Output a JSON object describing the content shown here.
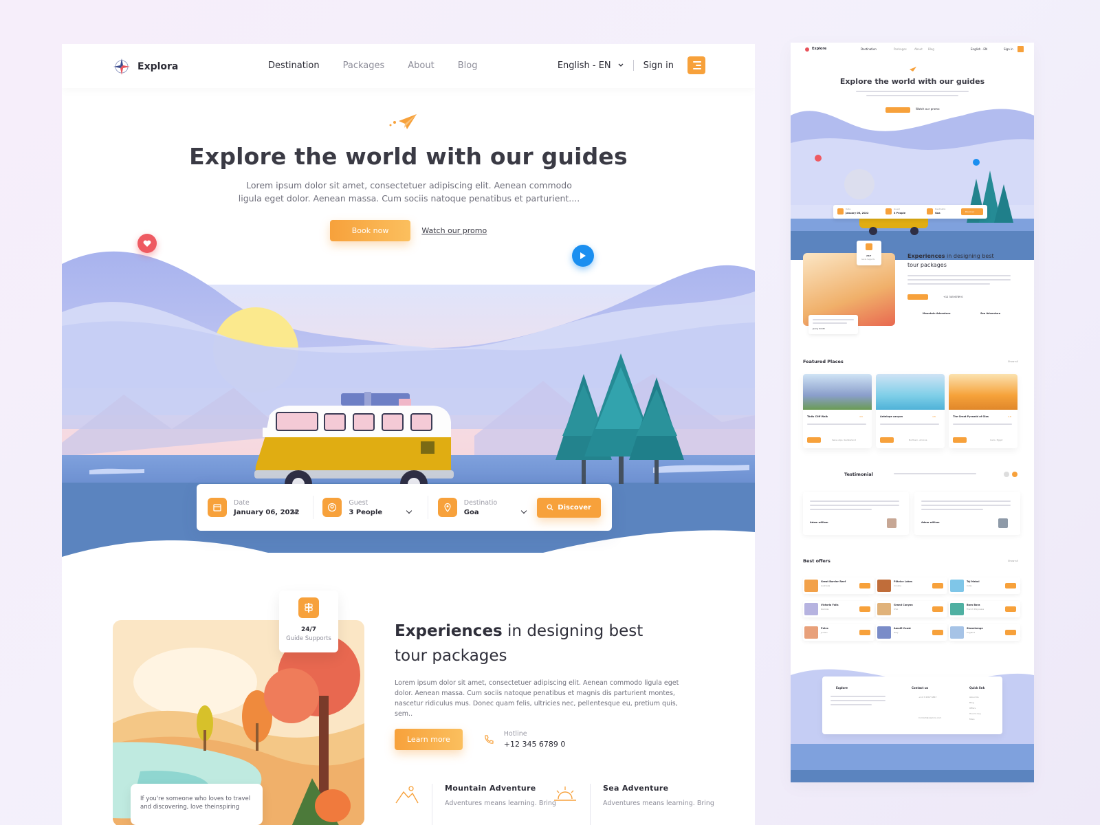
{
  "brand": {
    "name": "Explora",
    "accent": "#f7a13b"
  },
  "nav": {
    "links": [
      "Destination",
      "Packages",
      "About",
      "Blog"
    ],
    "language": "English - EN",
    "signin": "Sign in"
  },
  "hero": {
    "title": "Explore the world with our guides",
    "subtitle": "Lorem ipsum dolor sit amet, consectetuer adipiscing elit. Aenean commodo ligula eget dolor. Aenean massa. Cum sociis natoque penatibus et parturient....",
    "book_label": "Book now",
    "promo_label": "Watch our promo"
  },
  "search": {
    "date": {
      "label": "Date",
      "value": "January 06, 2022"
    },
    "guest": {
      "label": "Guest",
      "value": "3 People"
    },
    "destination": {
      "label": "Destinatio",
      "value": "Goa"
    },
    "discover_label": "Discover"
  },
  "experience": {
    "title_bold": "Experiences",
    "title_rest": " in designing best tour packages",
    "description": "Lorem ipsum dolor sit amet, consectetuer adipiscing elit. Aenean commodo ligula eget dolor. Aenean massa. Cum sociis natoque penatibus et magnis dis parturient montes, nascetur ridiculus mus. Donec quam felis, ultricies nec, pellentesque eu, pretium quis, sem..",
    "learn_label": "Learn more",
    "hotline_label": "Hotline",
    "hotline_value": "+12 345 6789 0",
    "guide_num": "24/7",
    "guide_label": "Guide Supports",
    "quote": "If you're someone who loves to travel and discovering, love theinspiring",
    "adventures": [
      {
        "title": "Mountain Adventure",
        "desc": "Adventures means learning. Bring"
      },
      {
        "title": "Sea Adventure",
        "desc": "Adventures means learning. Bring"
      }
    ]
  },
  "preview": {
    "brand": "Explore",
    "nav_links": [
      "Destination",
      "Packages",
      "About",
      "Blog"
    ],
    "lang": "English - EN",
    "signin": "Sign in",
    "hero_title": "Explore the world with our guides",
    "book": "Book now",
    "promo": "Watch our promo",
    "search": [
      {
        "label": "Date",
        "value": "January 06, 2022"
      },
      {
        "label": "Guest",
        "value": "3 People"
      },
      {
        "label": "Destinatio",
        "value": "Goa"
      }
    ],
    "discover": "Discover",
    "exp_title_bold": "Experiences",
    "exp_title_rest": " in designing best",
    "exp_title_line2": "tour packages",
    "hotline": "+12 345 6789 0",
    "guide_num": "24/7",
    "guide_label": "Guide Supports",
    "mountain": "Mountain Adventure",
    "sea": "Sea Adventure",
    "quote_name": "Jenny Smith",
    "featured_title": "Featured Places",
    "show_all": "Show all",
    "places": [
      {
        "name": "Tödis Cliff Walk",
        "rating": "4.8",
        "loc": "Swiss Alps, Switzerland"
      },
      {
        "name": "Antelope canyon",
        "rating": "4.8",
        "loc": "Northern, Arizona"
      },
      {
        "name": "The Great Pyramid of Giza",
        "rating": "4.8",
        "loc": "Cairo, Egypt"
      }
    ],
    "details": "Details",
    "testimonial_title": "Testimonial",
    "testimonials": [
      {
        "name": "Adam william"
      },
      {
        "name": "Adam william"
      }
    ],
    "offers_title": "Best offers",
    "offers": [
      {
        "name": "Great Barrier Reef",
        "loc": "Australia"
      },
      {
        "name": "Plitvice Lakes",
        "loc": "Croatia"
      },
      {
        "name": "Taj Mahal",
        "loc": "India"
      },
      {
        "name": "Victoria Falls",
        "loc": "Zambia"
      },
      {
        "name": "Grand Canyon",
        "loc": "USA"
      },
      {
        "name": "Bora Bora",
        "loc": "French Polynesia"
      },
      {
        "name": "Petra",
        "loc": "Jordan"
      },
      {
        "name": "Amalfi Coast",
        "loc": "Italy"
      },
      {
        "name": "Stonehenge",
        "loc": "England"
      }
    ],
    "footer_brand": "Explore",
    "contact_title": "Contact us",
    "quick_title": "Quick link",
    "phone": "+12 3 4567 6867",
    "email": "Contact@explora.com",
    "quick_links": [
      "About Us",
      "Blog",
      "Offers",
      "How to buy",
      "More"
    ]
  },
  "colors": {
    "orange": "#f7a13b",
    "water": "#5d86c1",
    "sky": "#b9c4f2",
    "van": "#e0ad12"
  }
}
